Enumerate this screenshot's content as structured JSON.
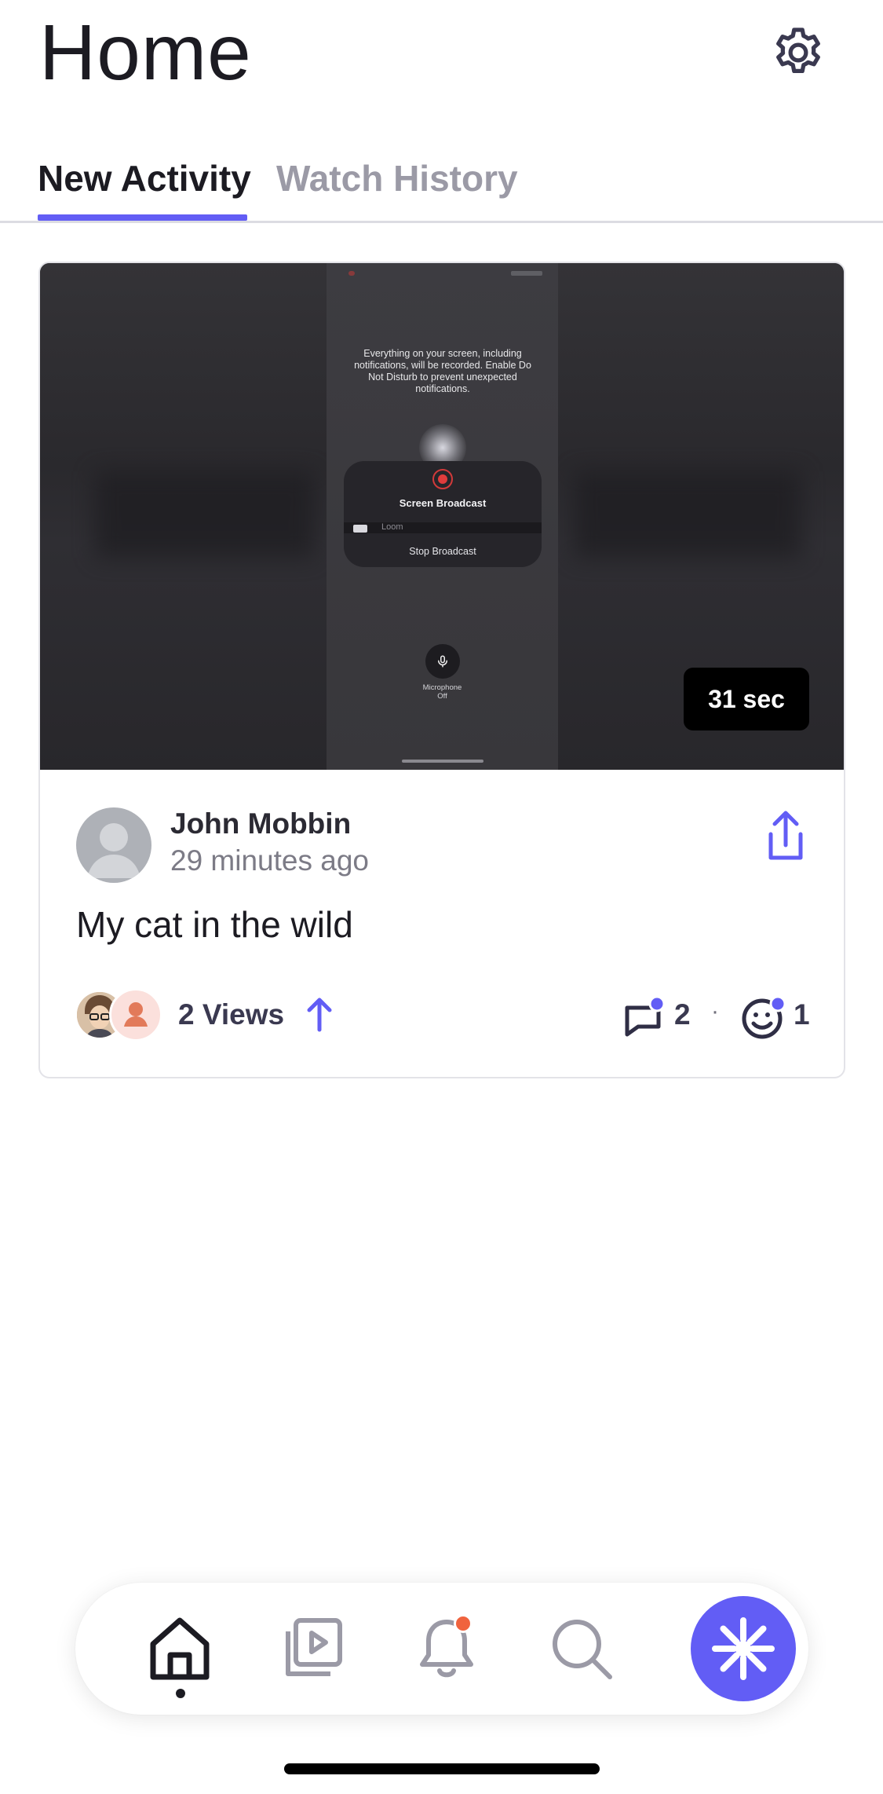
{
  "header": {
    "title": "Home",
    "settings_icon": "gear-icon"
  },
  "tabs": [
    {
      "label": "New Activity",
      "active": true
    },
    {
      "label": "Watch History",
      "active": false
    }
  ],
  "colors": {
    "accent": "#625df5",
    "badge": "#f0633e",
    "text": "#1c1b22",
    "muted": "#9b9aa6"
  },
  "video_card": {
    "thumbnail": {
      "notice": "Everything on your screen, including notifications, will be recorded. Enable Do Not Disturb to prevent unexpected notifications.",
      "broadcast_title": "Screen Broadcast",
      "app_name": "Loom",
      "stop_label": "Stop Broadcast",
      "mic_label": "Microphone",
      "mic_state": "Off"
    },
    "duration": "31 sec",
    "author": "John Mobbin",
    "time_ago": "29 minutes ago",
    "title": "My cat in the wild",
    "views_label": "2 Views",
    "comment_count": "2",
    "separator": "·",
    "reaction_count": "1"
  },
  "tabbar": {
    "items": [
      "home-icon",
      "video-library-icon",
      "bell-icon",
      "search-icon",
      "record-icon"
    ],
    "active": "home-icon",
    "notification_badge": true
  }
}
